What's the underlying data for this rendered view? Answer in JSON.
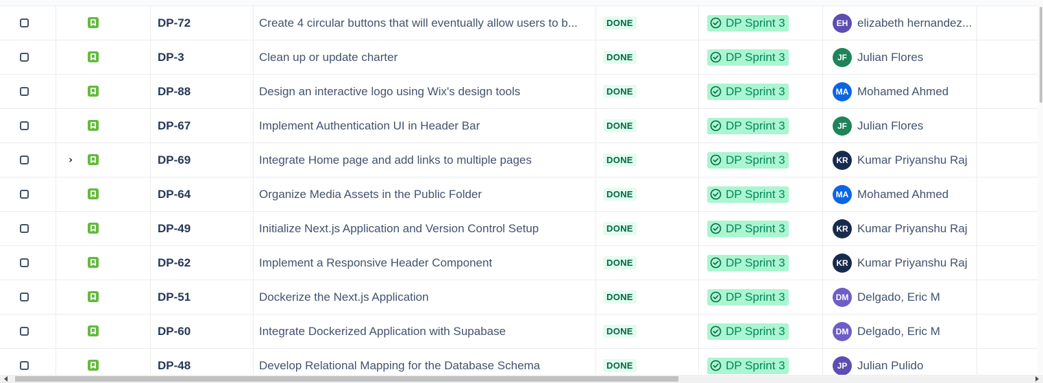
{
  "colors": {
    "story_icon": "#63ba3c",
    "done_lozenge_bg": "#e3fcef",
    "done_lozenge_text": "#006644",
    "sprint_bg": "#abf5d1",
    "sprint_text": "#00875a"
  },
  "icons": {
    "row_type": "bookmark-icon",
    "sprint": "check-circle-icon",
    "expand": "chevron-right-icon"
  },
  "rows": [
    {
      "key": "DP-72",
      "summary": "Create 4 circular buttons that will eventually allow users to b...",
      "status": "DONE",
      "sprint": "DP Sprint 3",
      "initials": "EH",
      "assignee": "elizabeth hernandez...",
      "avatar_color": "#5e4db2",
      "has_children": false
    },
    {
      "key": "DP-3",
      "summary": "Clean up or update charter",
      "status": "DONE",
      "sprint": "DP Sprint 3",
      "initials": "JF",
      "assignee": "Julian Flores",
      "avatar_color": "#1f845a",
      "has_children": false
    },
    {
      "key": "DP-88",
      "summary": "Design an interactive logo using Wix's design tools",
      "status": "DONE",
      "sprint": "DP Sprint 3",
      "initials": "MA",
      "assignee": "Mohamed Ahmed",
      "avatar_color": "#0c66e4",
      "has_children": false
    },
    {
      "key": "DP-67",
      "summary": "Implement Authentication UI in Header Bar",
      "status": "DONE",
      "sprint": "DP Sprint 3",
      "initials": "JF",
      "assignee": "Julian Flores",
      "avatar_color": "#1f845a",
      "has_children": false
    },
    {
      "key": "DP-69",
      "summary": "Integrate Home page and add links to multiple pages",
      "status": "DONE",
      "sprint": "DP Sprint 3",
      "initials": "KR",
      "assignee": "Kumar Priyanshu Raj",
      "avatar_color": "#172b4d",
      "has_children": true
    },
    {
      "key": "DP-64",
      "summary": "Organize Media Assets in the Public Folder",
      "status": "DONE",
      "sprint": "DP Sprint 3",
      "initials": "MA",
      "assignee": "Mohamed Ahmed",
      "avatar_color": "#0c66e4",
      "has_children": false
    },
    {
      "key": "DP-49",
      "summary": "Initialize Next.js Application and Version Control Setup",
      "status": "DONE",
      "sprint": "DP Sprint 3",
      "initials": "KR",
      "assignee": "Kumar Priyanshu Raj",
      "avatar_color": "#172b4d",
      "has_children": false
    },
    {
      "key": "DP-62",
      "summary": "Implement a Responsive Header Component",
      "status": "DONE",
      "sprint": "DP Sprint 3",
      "initials": "KR",
      "assignee": "Kumar Priyanshu Raj",
      "avatar_color": "#172b4d",
      "has_children": false
    },
    {
      "key": "DP-51",
      "summary": "Dockerize the Next.js Application",
      "status": "DONE",
      "sprint": "DP Sprint 3",
      "initials": "DM",
      "assignee": "Delgado, Eric M",
      "avatar_color": "#6e5dc6",
      "has_children": false
    },
    {
      "key": "DP-60",
      "summary": "Integrate Dockerized Application with Supabase",
      "status": "DONE",
      "sprint": "DP Sprint 3",
      "initials": "DM",
      "assignee": "Delgado, Eric M",
      "avatar_color": "#6e5dc6",
      "has_children": false
    },
    {
      "key": "DP-48",
      "summary": "Develop Relational Mapping for the Database Schema",
      "status": "DONE",
      "sprint": "DP Sprint 3",
      "initials": "JP",
      "assignee": "Julian Pulido",
      "avatar_color": "#5e4db2",
      "has_children": false
    }
  ]
}
